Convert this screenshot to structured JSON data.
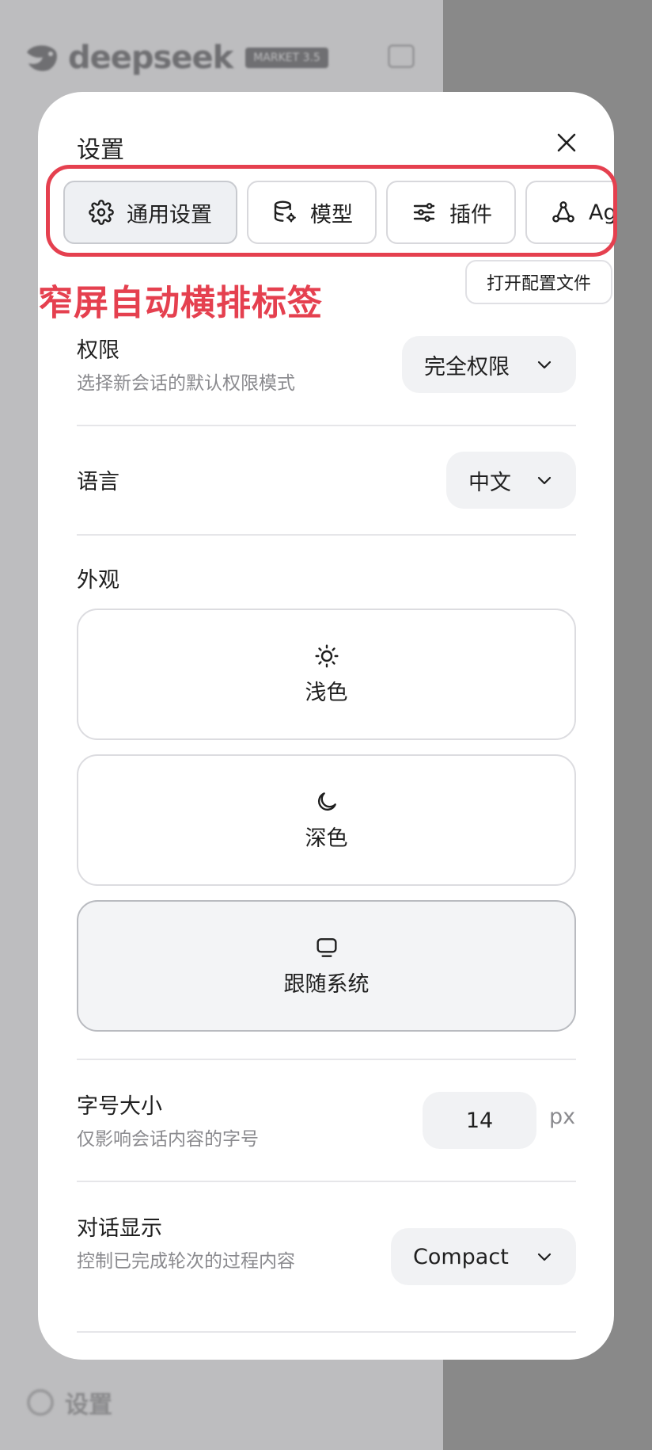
{
  "background": {
    "brand": "deepseek",
    "version_badge": "MARKET 3.5",
    "sidebar_settings_label": "设置"
  },
  "dialog": {
    "title": "设置",
    "tabs": [
      {
        "label": "通用设置",
        "icon": "gear-icon",
        "active": true
      },
      {
        "label": "模型",
        "icon": "database-gear-icon",
        "active": false
      },
      {
        "label": "插件",
        "icon": "sliders-icon",
        "active": false
      },
      {
        "label": "Agent",
        "icon": "nodes-icon",
        "active": false
      }
    ],
    "annotation": "窄屏自动横排标签",
    "open_config_label": "打开配置文件",
    "permission": {
      "label": "权限",
      "description": "选择新会话的默认权限模式",
      "value": "完全权限"
    },
    "language": {
      "label": "语言",
      "value": "中文"
    },
    "appearance": {
      "label": "外观",
      "options": [
        {
          "label": "浅色",
          "icon": "sun-icon",
          "selected": false
        },
        {
          "label": "深色",
          "icon": "moon-icon",
          "selected": false
        },
        {
          "label": "跟随系统",
          "icon": "monitor-icon",
          "selected": true
        }
      ]
    },
    "font_size": {
      "label": "字号大小",
      "description": "仅影响会话内容的字号",
      "value": "14",
      "unit": "px"
    },
    "conversation_display": {
      "label": "对话显示",
      "description": "控制已完成轮次的过程内容",
      "value": "Compact"
    }
  },
  "colors": {
    "annotation": "#e5404f",
    "overlay": "#bdbdbf",
    "selected_bg": "#f3f4f6"
  }
}
